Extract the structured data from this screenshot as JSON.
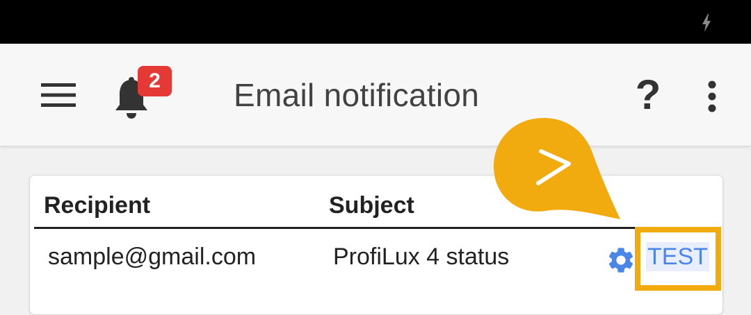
{
  "status_bar": {
    "icons": [
      "battery-charging-icon"
    ]
  },
  "app_bar": {
    "menu_icon": "menu-icon",
    "notifications": {
      "icon": "bell-icon",
      "badge_count": "2",
      "badge_color": "#e53935"
    },
    "title": "Email notification",
    "help_label": "?",
    "more_icon": "more-vert-icon"
  },
  "table": {
    "columns": [
      "Recipient",
      "Subject"
    ],
    "rows": [
      {
        "recipient": "sample@gmail.com",
        "subject": "ProfiLux 4 status",
        "settings_icon": "gear-icon",
        "test_label": "TEST"
      }
    ]
  },
  "tutorial": {
    "pointer_icon": "chevron-right-icon",
    "highlight_color": "#f2ab0f"
  },
  "colors": {
    "accent_link": "#4a86e8",
    "status_bar_bg": "#000000",
    "app_bar_bg": "#f7f7f7"
  }
}
